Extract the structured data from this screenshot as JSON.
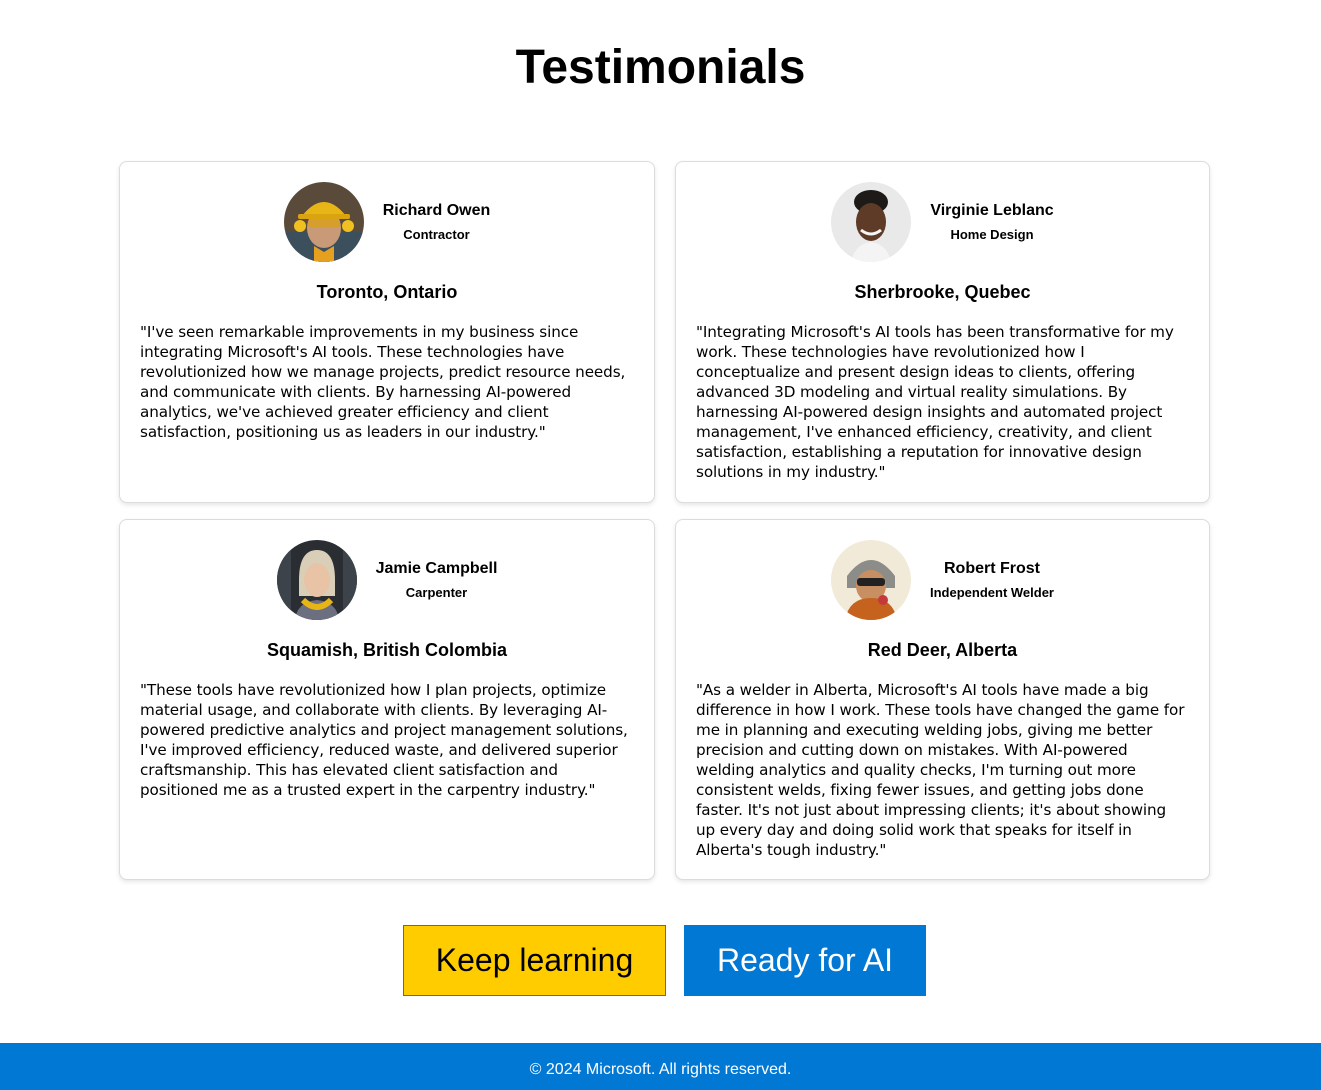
{
  "page": {
    "title": "Testimonials"
  },
  "testimonials": [
    {
      "name": "Richard Owen",
      "role": "Contractor",
      "location": "Toronto, Ontario",
      "quote": "\"I've seen remarkable improvements in my business since integrating Microsoft's AI tools. These technologies have revolutionized how we manage projects, predict resource needs, and communicate with clients. By harnessing AI-powered analytics, we've achieved greater efficiency and client satisfaction, positioning us as leaders in our industry.\""
    },
    {
      "name": "Virginie Leblanc",
      "role": "Home Design",
      "location": "Sherbrooke, Quebec",
      "quote": "\"Integrating Microsoft's AI tools has been transformative for my work. These technologies have revolutionized how I conceptualize and present design ideas to clients, offering advanced 3D modeling and virtual reality simulations. By harnessing AI-powered design insights and automated project management, I've enhanced efficiency, creativity, and client satisfaction, establishing a reputation for innovative design solutions in my industry.\""
    },
    {
      "name": "Jamie Campbell",
      "role": "Carpenter",
      "location": "Squamish, British Colombia",
      "quote": "\"These tools have revolutionized how I plan projects, optimize material usage, and collaborate with clients. By leveraging AI-powered predictive analytics and project management solutions, I've improved efficiency, reduced waste, and delivered superior craftsmanship. This has elevated client satisfaction and positioned me as a trusted expert in the carpentry industry.\""
    },
    {
      "name": "Robert Frost",
      "role": "Independent Welder",
      "location": "Red Deer, Alberta",
      "quote": "\"As a welder in Alberta, Microsoft's AI tools have made a big difference in how I work. These tools have changed the game for me in planning and executing welding jobs, giving me better precision and cutting down on mistakes. With AI-powered welding analytics and quality checks, I'm turning out more consistent welds, fixing fewer issues, and getting jobs done faster. It's not just about impressing clients; it's about showing up every day and doing solid work that speaks for itself in Alberta's tough industry.\""
    }
  ],
  "buttons": {
    "keep_learning": "Keep learning",
    "ready_for_ai": "Ready for AI"
  },
  "colors": {
    "keep_learning_bg": "#ffcc00",
    "ready_for_ai_bg": "#0078d4",
    "footer_bg": "#0078d4"
  },
  "footer": {
    "text": "© 2024 Microsoft. All rights reserved."
  }
}
